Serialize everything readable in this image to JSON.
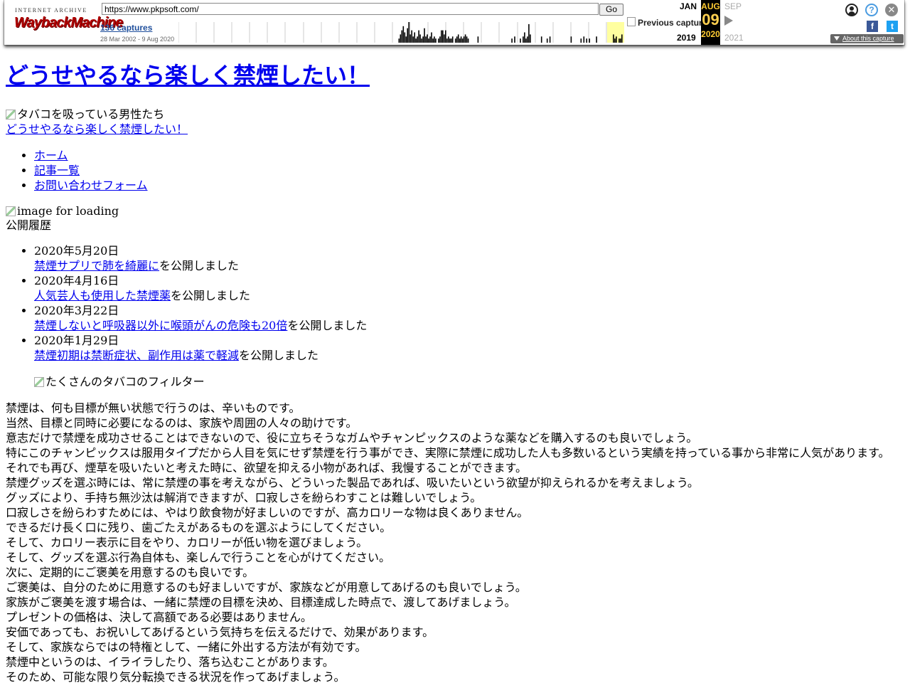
{
  "toolbar": {
    "logo_top": "INTERNET ARCHIVE",
    "logo_main": "WaybackMachine",
    "url": "https://www.pkpsoft.com/",
    "go_label": "Go",
    "captures": "136 captures",
    "range": "28 Mar 2002 - 9 Aug 2020",
    "prev_capture": "Previous capture",
    "month_prev": "JAN",
    "month_cur": "AUG",
    "month_next": "SEP",
    "day_cur": "09",
    "year_prev": "2019",
    "year_cur": "2020",
    "year_next": "2021",
    "help_glyph": "?",
    "close_glyph": "✕",
    "fb_glyph": "f",
    "tw_glyph": "t",
    "about": "About this capture",
    "sparkline": [
      0,
      0,
      0,
      0,
      0,
      0,
      0,
      0,
      0,
      0,
      0,
      0,
      0,
      0,
      0,
      0,
      0,
      0,
      0,
      0,
      0,
      0,
      0,
      0,
      0,
      0,
      0,
      0,
      0,
      0,
      0,
      0,
      0,
      0,
      0,
      0,
      0,
      0,
      0,
      0,
      0,
      0,
      0,
      0,
      0,
      0,
      0,
      0,
      0,
      0,
      0,
      0,
      0,
      0,
      0,
      0,
      0,
      0,
      0,
      0,
      0,
      0,
      0,
      0,
      0,
      0,
      0,
      0,
      0,
      0,
      0,
      0,
      0,
      0,
      0,
      0,
      0,
      0,
      0,
      0,
      0,
      0,
      0,
      0,
      0,
      0,
      0,
      0,
      0,
      0,
      0,
      0,
      0,
      0,
      0,
      0,
      0,
      0,
      0,
      0,
      0,
      0,
      0,
      0,
      0,
      0,
      0,
      0,
      0,
      0,
      0,
      0,
      0,
      0,
      0,
      0,
      0,
      0,
      0,
      0,
      0,
      0,
      0,
      0,
      0,
      0,
      0,
      0,
      0,
      0,
      0,
      0,
      0,
      0,
      0,
      0,
      0,
      0,
      0,
      0,
      0,
      0,
      0,
      0,
      0,
      0,
      0,
      0,
      0,
      0,
      0,
      0,
      0,
      0,
      0,
      0,
      0.2,
      0.4,
      0.6,
      0.8,
      0.5,
      0.3,
      0.7,
      1,
      0.4,
      0.6,
      0.3,
      0.5,
      0.2,
      0.3,
      0.6,
      0.4,
      0.2,
      0.3,
      0.7,
      0.3,
      0.4,
      0.2,
      0.3,
      0.5,
      0.2,
      0.3,
      0.2,
      0,
      0.2,
      0.3,
      0.6,
      0.6,
      0.4,
      0.6,
      0.2,
      0.3,
      0.2,
      0.2,
      0.3,
      0,
      0.2,
      0.3,
      0.4,
      0.2,
      0.3,
      0.2,
      0.3,
      0.4,
      0.3,
      0.2,
      0,
      0,
      0,
      0,
      0,
      0,
      0.3,
      0,
      0,
      0,
      0,
      0,
      0,
      0,
      0,
      0,
      0,
      0,
      0,
      0,
      0,
      0,
      0,
      0,
      0,
      0,
      0,
      0,
      0,
      0,
      0.2,
      0,
      0.3,
      0,
      0,
      0,
      0.2,
      0,
      0.3,
      0.5,
      0.2,
      0.3,
      0.9,
      0.4,
      0,
      0,
      0,
      0,
      0,
      0,
      0,
      0.3,
      0,
      0,
      0,
      0.2,
      0,
      0.3,
      0,
      0,
      0,
      0,
      0,
      0,
      0,
      0,
      0,
      0,
      0,
      0,
      0,
      0,
      0.3,
      0,
      0,
      0,
      0,
      0,
      0,
      0.2,
      0,
      0.3,
      0,
      0.2,
      0,
      0.2,
      0,
      0,
      0,
      0,
      0.3,
      0,
      0,
      0,
      0,
      0,
      0,
      0,
      0,
      0,
      0,
      0,
      0.4,
      0.2,
      0.3,
      0,
      0.2,
      0.2,
      0.4,
      0
    ]
  },
  "page": {
    "title": "どうせやるなら楽しく禁煙したい！",
    "hero_alt": "タバコを吸っている男性たち",
    "hero_link": "どうせやるなら楽しく禁煙したい！",
    "nav": [
      "ホーム",
      "記事一覧",
      "お問い合わせフォーム"
    ],
    "loading_alt": "image for loading",
    "history_title": "公開履歴",
    "history": [
      {
        "date": "2020年5月20日",
        "link": "禁煙サプリで肺を綺麗に",
        "suffix": "を公開しました"
      },
      {
        "date": "2020年4月16日",
        "link": "人気芸人も使用した禁煙薬",
        "suffix": "を公開しました"
      },
      {
        "date": "2020年3月22日",
        "link": "禁煙しないと呼吸器以外に喉頭がんの危険も20倍",
        "suffix": "を公開しました"
      },
      {
        "date": "2020年1月29日",
        "link": "禁煙初期は禁断症状、副作用は薬で軽減",
        "suffix": "を公開しました"
      }
    ],
    "filter_alt": "たくさんのタバコのフィルター",
    "paragraphs": [
      "禁煙は、何も目標が無い状態で行うのは、辛いものです。",
      "当然、目標と同時に必要になるのは、家族や周囲の人々の助けです。",
      "意志だけで禁煙を成功させることはできないので、役に立ちそうなガムやチャンピックスのような薬などを購入するのも良いでしょう。",
      "特にこのチャンピックスは服用タイプだから人目を気にせず禁煙を行う事ができ、実際に禁煙に成功した人も多数いるという実績を持っている事から非常に人気があります。",
      "それでも再び、煙草を吸いたいと考えた時に、欲望を抑える小物があれば、我慢することができます。",
      "禁煙グッズを選ぶ時には、常に禁煙の事を考えながら、どういった製品であれば、吸いたいという欲望が抑えられるかを考えましょう。",
      "グッズにより、手持ち無沙汰は解消できますが、口寂しさを紛らわすことは難しいでしょう。",
      "口寂しさを紛らわすためには、やはり飲食物が好ましいのですが、高カロリーな物は良くありません。",
      "できるだけ長く口に残り、歯ごたえがあるものを選ぶようにしてください。",
      "そして、カロリー表示に目をやり、カロリーが低い物を選びましょう。",
      "そして、グッズを選ぶ行為自体も、楽しんで行うことを心がけてください。",
      "次に、定期的にご褒美を用意するのも良いです。",
      "ご褒美は、自分のために用意するのも好ましいですが、家族などが用意してあげるのも良いでしょう。",
      "家族がご褒美を渡す場合は、一緒に禁煙の目標を決め、目標達成した時点で、渡してあげましょう。",
      "プレゼントの価格は、決して高額である必要はありません。",
      "安価であっても、お祝いしてあげるという気持ちを伝えるだけで、効果があります。",
      "そして、家族ならではの特権として、一緒に外出する方法が有効です。",
      "禁煙中というのは、イライラしたり、落ち込むことがあります。",
      "そのため、可能な限り気分転換できる状況を作ってあげましょう。"
    ]
  }
}
